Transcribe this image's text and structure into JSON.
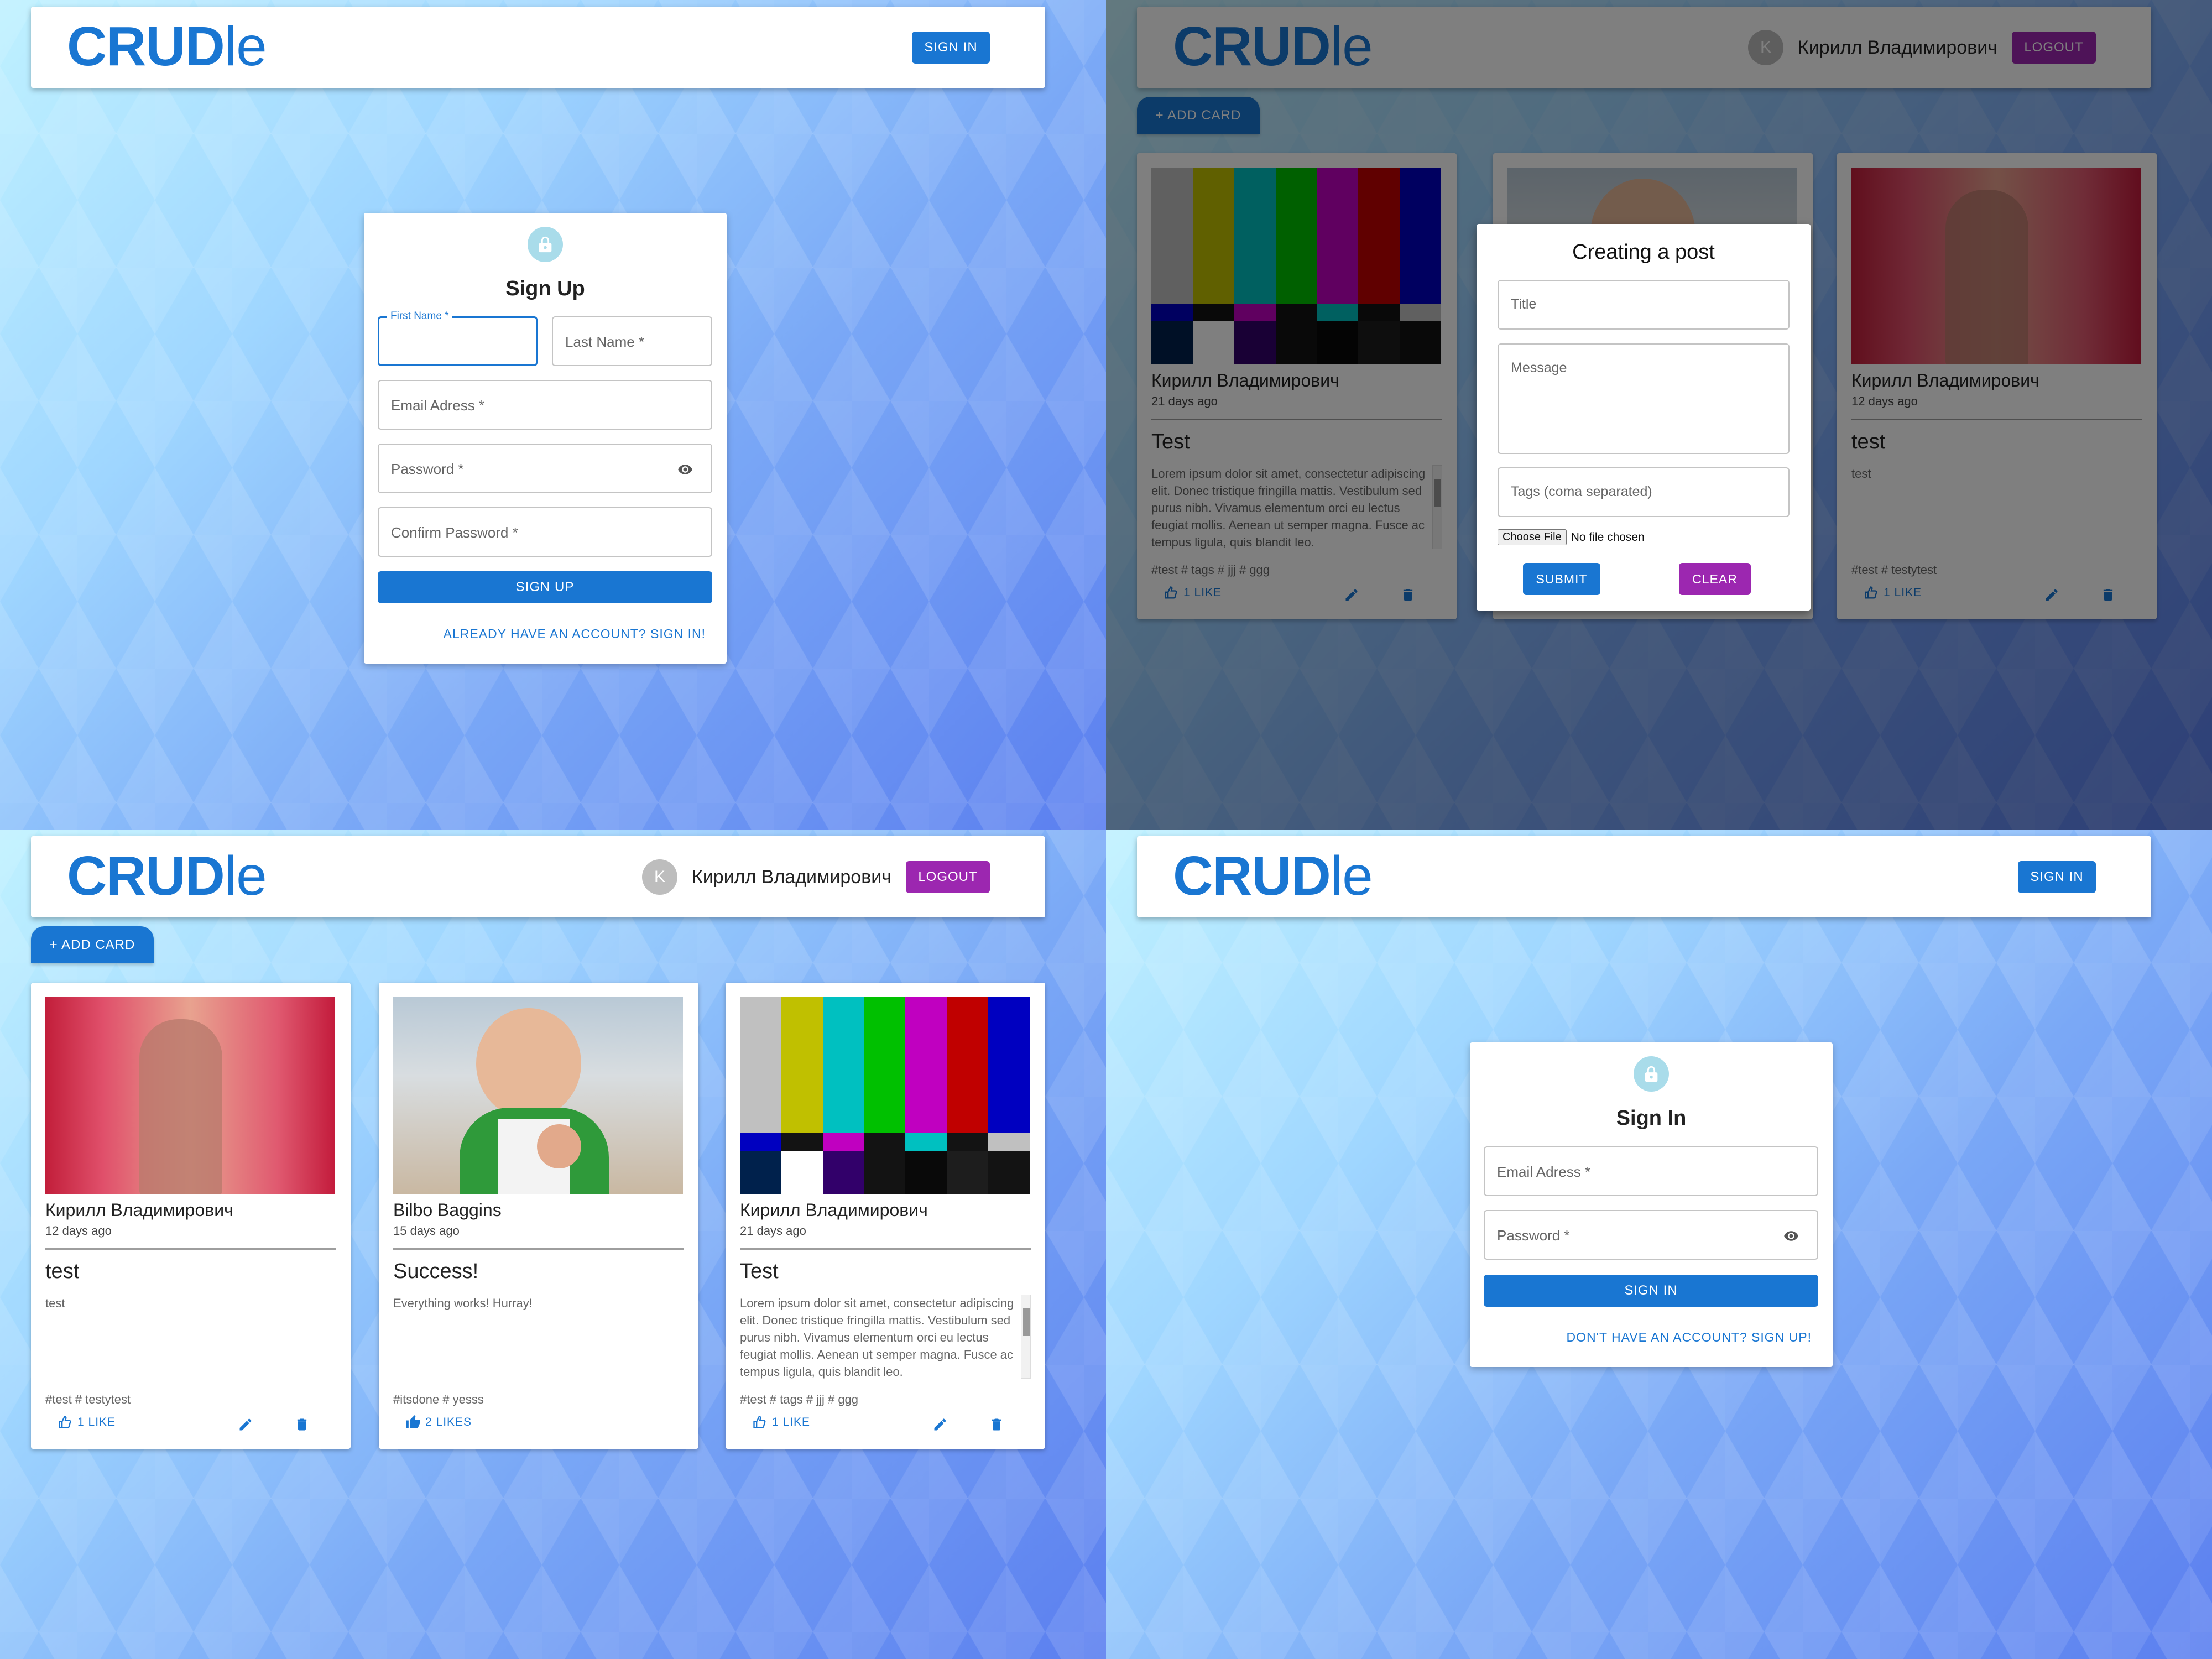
{
  "brand": {
    "part1": "CRUD",
    "part2": "le"
  },
  "topbar": {
    "signin_label": "SIGN IN",
    "logout_label": "LOGOUT",
    "avatar_letter": "K",
    "user_name": "Кирилл Владимирович"
  },
  "feed": {
    "add_card_label": "+ ADD CARD"
  },
  "cards_feed": [
    {
      "author": "Кирилл Владимирович",
      "date": "12 days ago",
      "title": "test",
      "message": "test",
      "tags": "#test # testytest",
      "likes": "1 LIKE",
      "image": "red-robed-figure"
    },
    {
      "author": "Bilbo Baggins",
      "date": "15 days ago",
      "title": "Success!",
      "message": "Everything works! Hurray!",
      "tags": "#itsdone # yesss",
      "likes": "2 LIKES",
      "image": "success-kid"
    },
    {
      "author": "Кирилл Владимирович",
      "date": "21 days ago",
      "title": "Test",
      "message": "Lorem ipsum dolor sit amet, consectetur adipiscing elit. Donec tristique fringilla mattis. Vestibulum sed purus nibh. Vivamus elementum orci eu lectus feugiat mollis. Aenean ut semper magna. Fusce ac tempus ligula, quis blandit leo.",
      "tags": "#test # tags # jjj # ggg",
      "likes": "1 LIKE",
      "image": "tv-color-bars"
    }
  ],
  "cards_modal_bg": [
    {
      "author": "Кирилл Владимирович",
      "date": "21 days ago",
      "title": "Test",
      "message": "Lorem ipsum dolor sit amet, consectetur adipiscing elit. Donec tristique fringilla mattis. Vestibulum sed purus nibh. Vivamus elementum orci eu lectus feugiat mollis. Aenean ut semper magna. Fusce ac tempus ligula, quis blandit leo.",
      "tags": "#test # tags # jjj # ggg",
      "likes": "1 LIKE",
      "image": "tv-color-bars"
    },
    {
      "author": "",
      "date": "",
      "title": "",
      "message": "",
      "tags": "",
      "likes": "",
      "image": "success-kid"
    },
    {
      "author": "Кирилл Владимирович",
      "date": "12 days ago",
      "title": "test",
      "message": "test",
      "tags": "#test # testytest",
      "likes": "1 LIKE",
      "image": "red-robed-figure"
    }
  ],
  "signup": {
    "title": "Sign Up",
    "first_name_label": "First Name *",
    "last_name_placeholder": "Last Name *",
    "email_placeholder": "Email Adress *",
    "password_placeholder": "Password *",
    "confirm_placeholder": "Confirm Password *",
    "submit_label": "SIGN UP",
    "switch_link": "ALREADY HAVE AN ACCOUNT? SIGN IN!"
  },
  "signin": {
    "title": "Sign In",
    "email_placeholder": "Email Adress *",
    "password_placeholder": "Password *",
    "submit_label": "SIGN IN",
    "switch_link": "DON'T HAVE AN ACCOUNT? SIGN UP!"
  },
  "post_modal": {
    "title": "Creating a post",
    "title_placeholder": "Title",
    "message_placeholder": "Message",
    "tags_placeholder": "Tags (coma separated)",
    "file_button": "Choose File",
    "file_status": "No file chosen",
    "submit_label": "SUBMIT",
    "clear_label": "CLEAR"
  },
  "colors": {
    "primary": "#1976d2",
    "secondary": "#9c27b0",
    "lock_bg": "#a9dcea"
  },
  "icons": [
    "lock-icon",
    "eye-icon",
    "thumb-up-icon",
    "edit-icon",
    "delete-icon"
  ]
}
